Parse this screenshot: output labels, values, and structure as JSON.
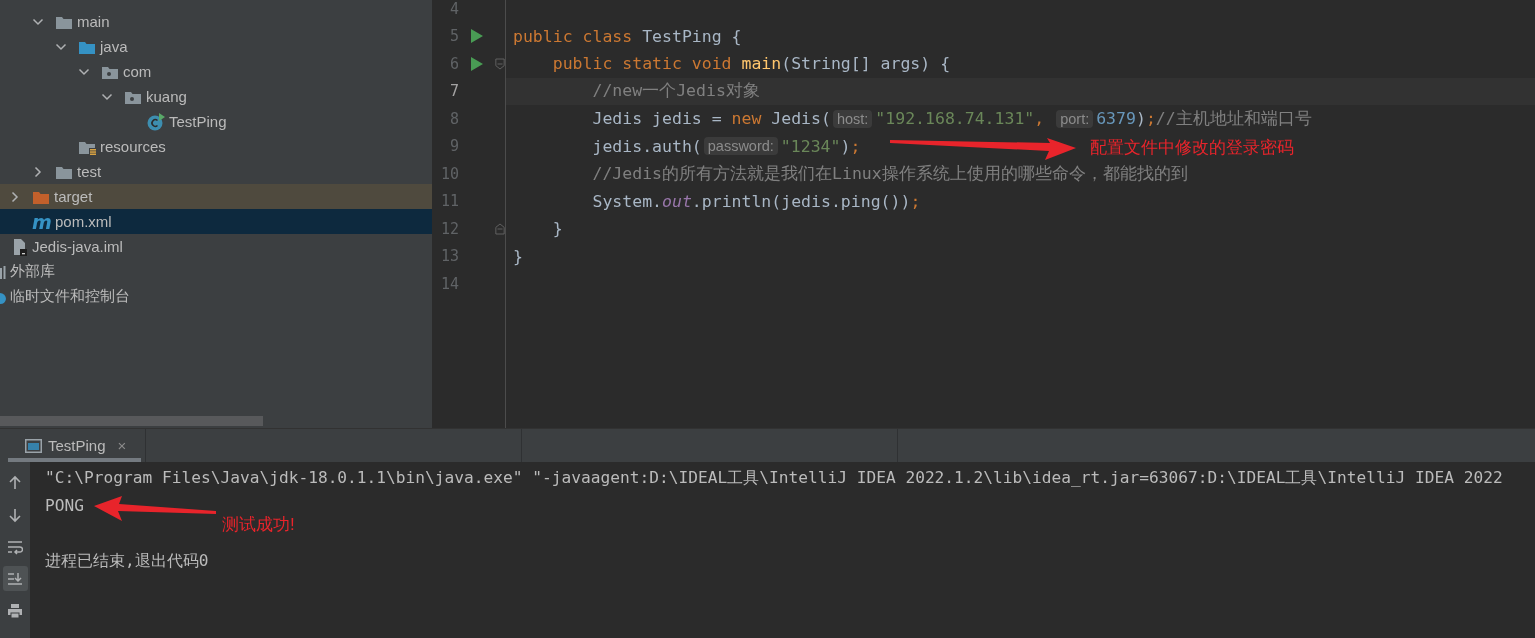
{
  "project_tree": [
    {
      "label": "main",
      "kind": "folder",
      "expanded": true,
      "selected": false,
      "highlighted": false,
      "children": [
        {
          "label": "java",
          "kind": "source_folder",
          "expanded": true,
          "selected": false,
          "highlighted": false,
          "children": [
            {
              "label": "com",
              "kind": "package",
              "expanded": true,
              "selected": false,
              "highlighted": false,
              "children": [
                {
                  "label": "kuang",
                  "kind": "package",
                  "expanded": true,
                  "selected": false,
                  "highlighted": false,
                  "children": [
                    {
                      "label": "TestPing",
                      "kind": "java_class",
                      "selected": false,
                      "highlighted": false
                    }
                  ]
                }
              ]
            }
          ]
        },
        {
          "label": "resources",
          "kind": "resources_folder",
          "selected": false,
          "highlighted": false
        }
      ]
    },
    {
      "label": "test",
      "kind": "folder",
      "expanded": false,
      "selected": false,
      "highlighted": false
    },
    {
      "label": "target",
      "kind": "excluded_folder",
      "expanded": false,
      "selected": false,
      "highlighted": true
    },
    {
      "label": "pom.xml",
      "kind": "maven",
      "icon_text": "m",
      "selected": true,
      "highlighted": false
    },
    {
      "label": "Jedis-java.iml",
      "kind": "module_file",
      "selected": false,
      "highlighted": false
    },
    {
      "label": "外部库",
      "kind": "library",
      "selected": false,
      "highlighted": false
    },
    {
      "label": "临时文件和控制台",
      "kind": "scratches",
      "selected": false,
      "highlighted": false
    }
  ],
  "editor": {
    "lines": [
      {
        "number": "4",
        "current": false,
        "run_marker": false,
        "fold_start": false,
        "fold_end": false
      },
      {
        "number": "5",
        "current": false,
        "run_marker": true,
        "fold_start": false,
        "fold_end": false,
        "tokens": [
          {
            "kind": "keyword",
            "text": "public class "
          },
          {
            "kind": "plain",
            "text": "TestPing {"
          }
        ]
      },
      {
        "number": "6",
        "current": false,
        "run_marker": true,
        "fold_start": true,
        "fold_end": false,
        "tokens": [
          {
            "kind": "keyword",
            "text": "    public static void "
          },
          {
            "kind": "method",
            "text": "main"
          },
          {
            "kind": "plain",
            "text": "(String[] args) {"
          }
        ]
      },
      {
        "number": "7",
        "current": true,
        "run_marker": false,
        "fold_start": false,
        "fold_end": false,
        "tokens": [
          {
            "kind": "comment",
            "text": "        //new一个Jedis对象"
          }
        ]
      },
      {
        "number": "8",
        "current": false,
        "run_marker": false,
        "fold_start": false,
        "fold_end": false,
        "tokens": [
          {
            "kind": "plain",
            "text": "        Jedis jedis = "
          },
          {
            "kind": "keyword",
            "text": "new "
          },
          {
            "kind": "plain",
            "text": "Jedis("
          },
          {
            "kind": "hint",
            "text": "host:"
          },
          {
            "kind": "string",
            "text": "\"192.168.74.131\""
          },
          {
            "kind": "keyword",
            "text": ", "
          },
          {
            "kind": "hint",
            "text": "port:"
          },
          {
            "kind": "number",
            "text": "6379"
          },
          {
            "kind": "plain",
            "text": ")"
          },
          {
            "kind": "keyword",
            "text": ";"
          },
          {
            "kind": "comment",
            "text": "//主机地址和端口号"
          }
        ]
      },
      {
        "number": "9",
        "current": false,
        "run_marker": false,
        "fold_start": false,
        "fold_end": false,
        "tokens": [
          {
            "kind": "plain",
            "text": "        jedis.auth("
          },
          {
            "kind": "hint",
            "text": "password:"
          },
          {
            "kind": "string",
            "text": "\"1234\""
          },
          {
            "kind": "plain",
            "text": ")"
          },
          {
            "kind": "keyword",
            "text": ";"
          }
        ]
      },
      {
        "number": "10",
        "current": false,
        "run_marker": false,
        "fold_start": false,
        "fold_end": false,
        "tokens": [
          {
            "kind": "comment",
            "text": "        //Jedis的所有方法就是我们在Linux操作系统上使用的哪些命令，都能找的到"
          }
        ]
      },
      {
        "number": "11",
        "current": false,
        "run_marker": false,
        "fold_start": false,
        "fold_end": false,
        "tokens": [
          {
            "kind": "plain",
            "text": "        System."
          },
          {
            "kind": "field",
            "text": "out"
          },
          {
            "kind": "plain",
            "text": ".println(jedis.ping())"
          },
          {
            "kind": "keyword",
            "text": ";"
          }
        ]
      },
      {
        "number": "12",
        "current": false,
        "run_marker": false,
        "fold_start": false,
        "fold_end": true,
        "tokens": [
          {
            "kind": "plain",
            "text": "    }"
          }
        ]
      },
      {
        "number": "13",
        "current": false,
        "run_marker": false,
        "fold_start": false,
        "fold_end": false,
        "tokens": [
          {
            "kind": "plain",
            "text": "}"
          }
        ]
      },
      {
        "number": "14",
        "current": false,
        "run_marker": false,
        "fold_start": false,
        "fold_end": false
      }
    ]
  },
  "run_panel": {
    "tabs": [
      {
        "label": "TestPing",
        "close": "×",
        "selected": true
      }
    ],
    "toolbar": [
      {
        "kind": "up",
        "on": false
      },
      {
        "kind": "down",
        "on": false
      },
      {
        "kind": "wrap",
        "on": false
      },
      {
        "kind": "scroll_end",
        "on": true
      },
      {
        "kind": "print",
        "on": false
      }
    ],
    "console": [
      {
        "kind": "command",
        "text": "\"C:\\Program Files\\Java\\jdk-18.0.1.1\\bin\\java.exe\" \"-javaagent:D:\\IDEAL工具\\IntelliJ IDEA 2022.1.2\\lib\\idea_rt.jar=63067:D:\\IDEAL工具\\IntelliJ IDEA 2022"
      },
      {
        "kind": "output",
        "text": "PONG"
      },
      {
        "kind": "exit",
        "text": "进程已结束,退出代码0"
      }
    ]
  },
  "annotations": [
    {
      "text": "配置文件中修改的登录密码"
    },
    {
      "text": "测试成功!"
    }
  ]
}
